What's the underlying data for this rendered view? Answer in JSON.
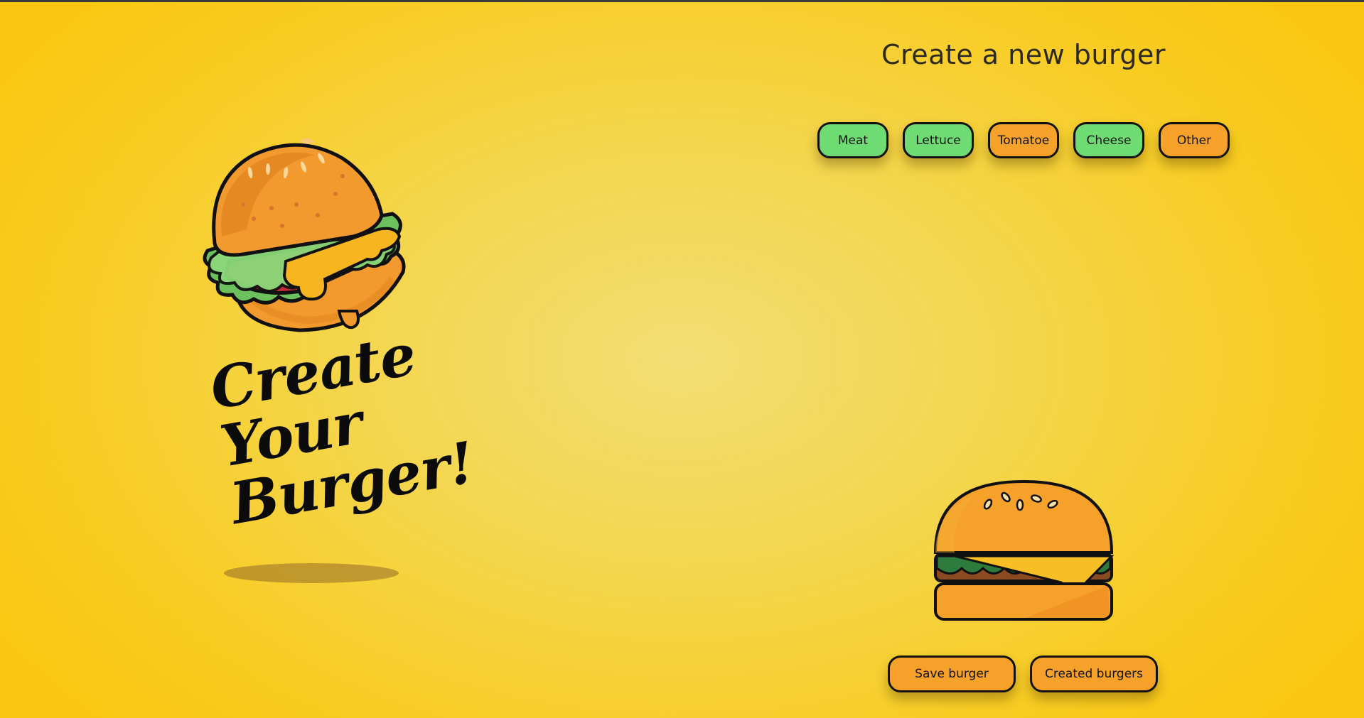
{
  "hero": {
    "tagline": "Create Your Burger!",
    "illustration": "burger-illustration-icon"
  },
  "builder": {
    "title": "Create a new burger",
    "ingredients": [
      {
        "label": "Meat",
        "state": "selected",
        "color": "#6fdc73"
      },
      {
        "label": "Lettuce",
        "state": "selected",
        "color": "#6fdc73"
      },
      {
        "label": "Tomatoe",
        "state": "unselected",
        "color": "#f6a12a"
      },
      {
        "label": "Cheese",
        "state": "selected",
        "color": "#6fdc73"
      },
      {
        "label": "Other",
        "state": "unselected",
        "color": "#f6a12a"
      }
    ],
    "preview": "burger-preview-icon",
    "actions": {
      "save_label": "Save burger",
      "list_label": "Created burgers"
    }
  },
  "colors": {
    "background": "#f4d64d",
    "selected": "#6fdc73",
    "unselected": "#f6a12a",
    "outline": "#111111"
  }
}
